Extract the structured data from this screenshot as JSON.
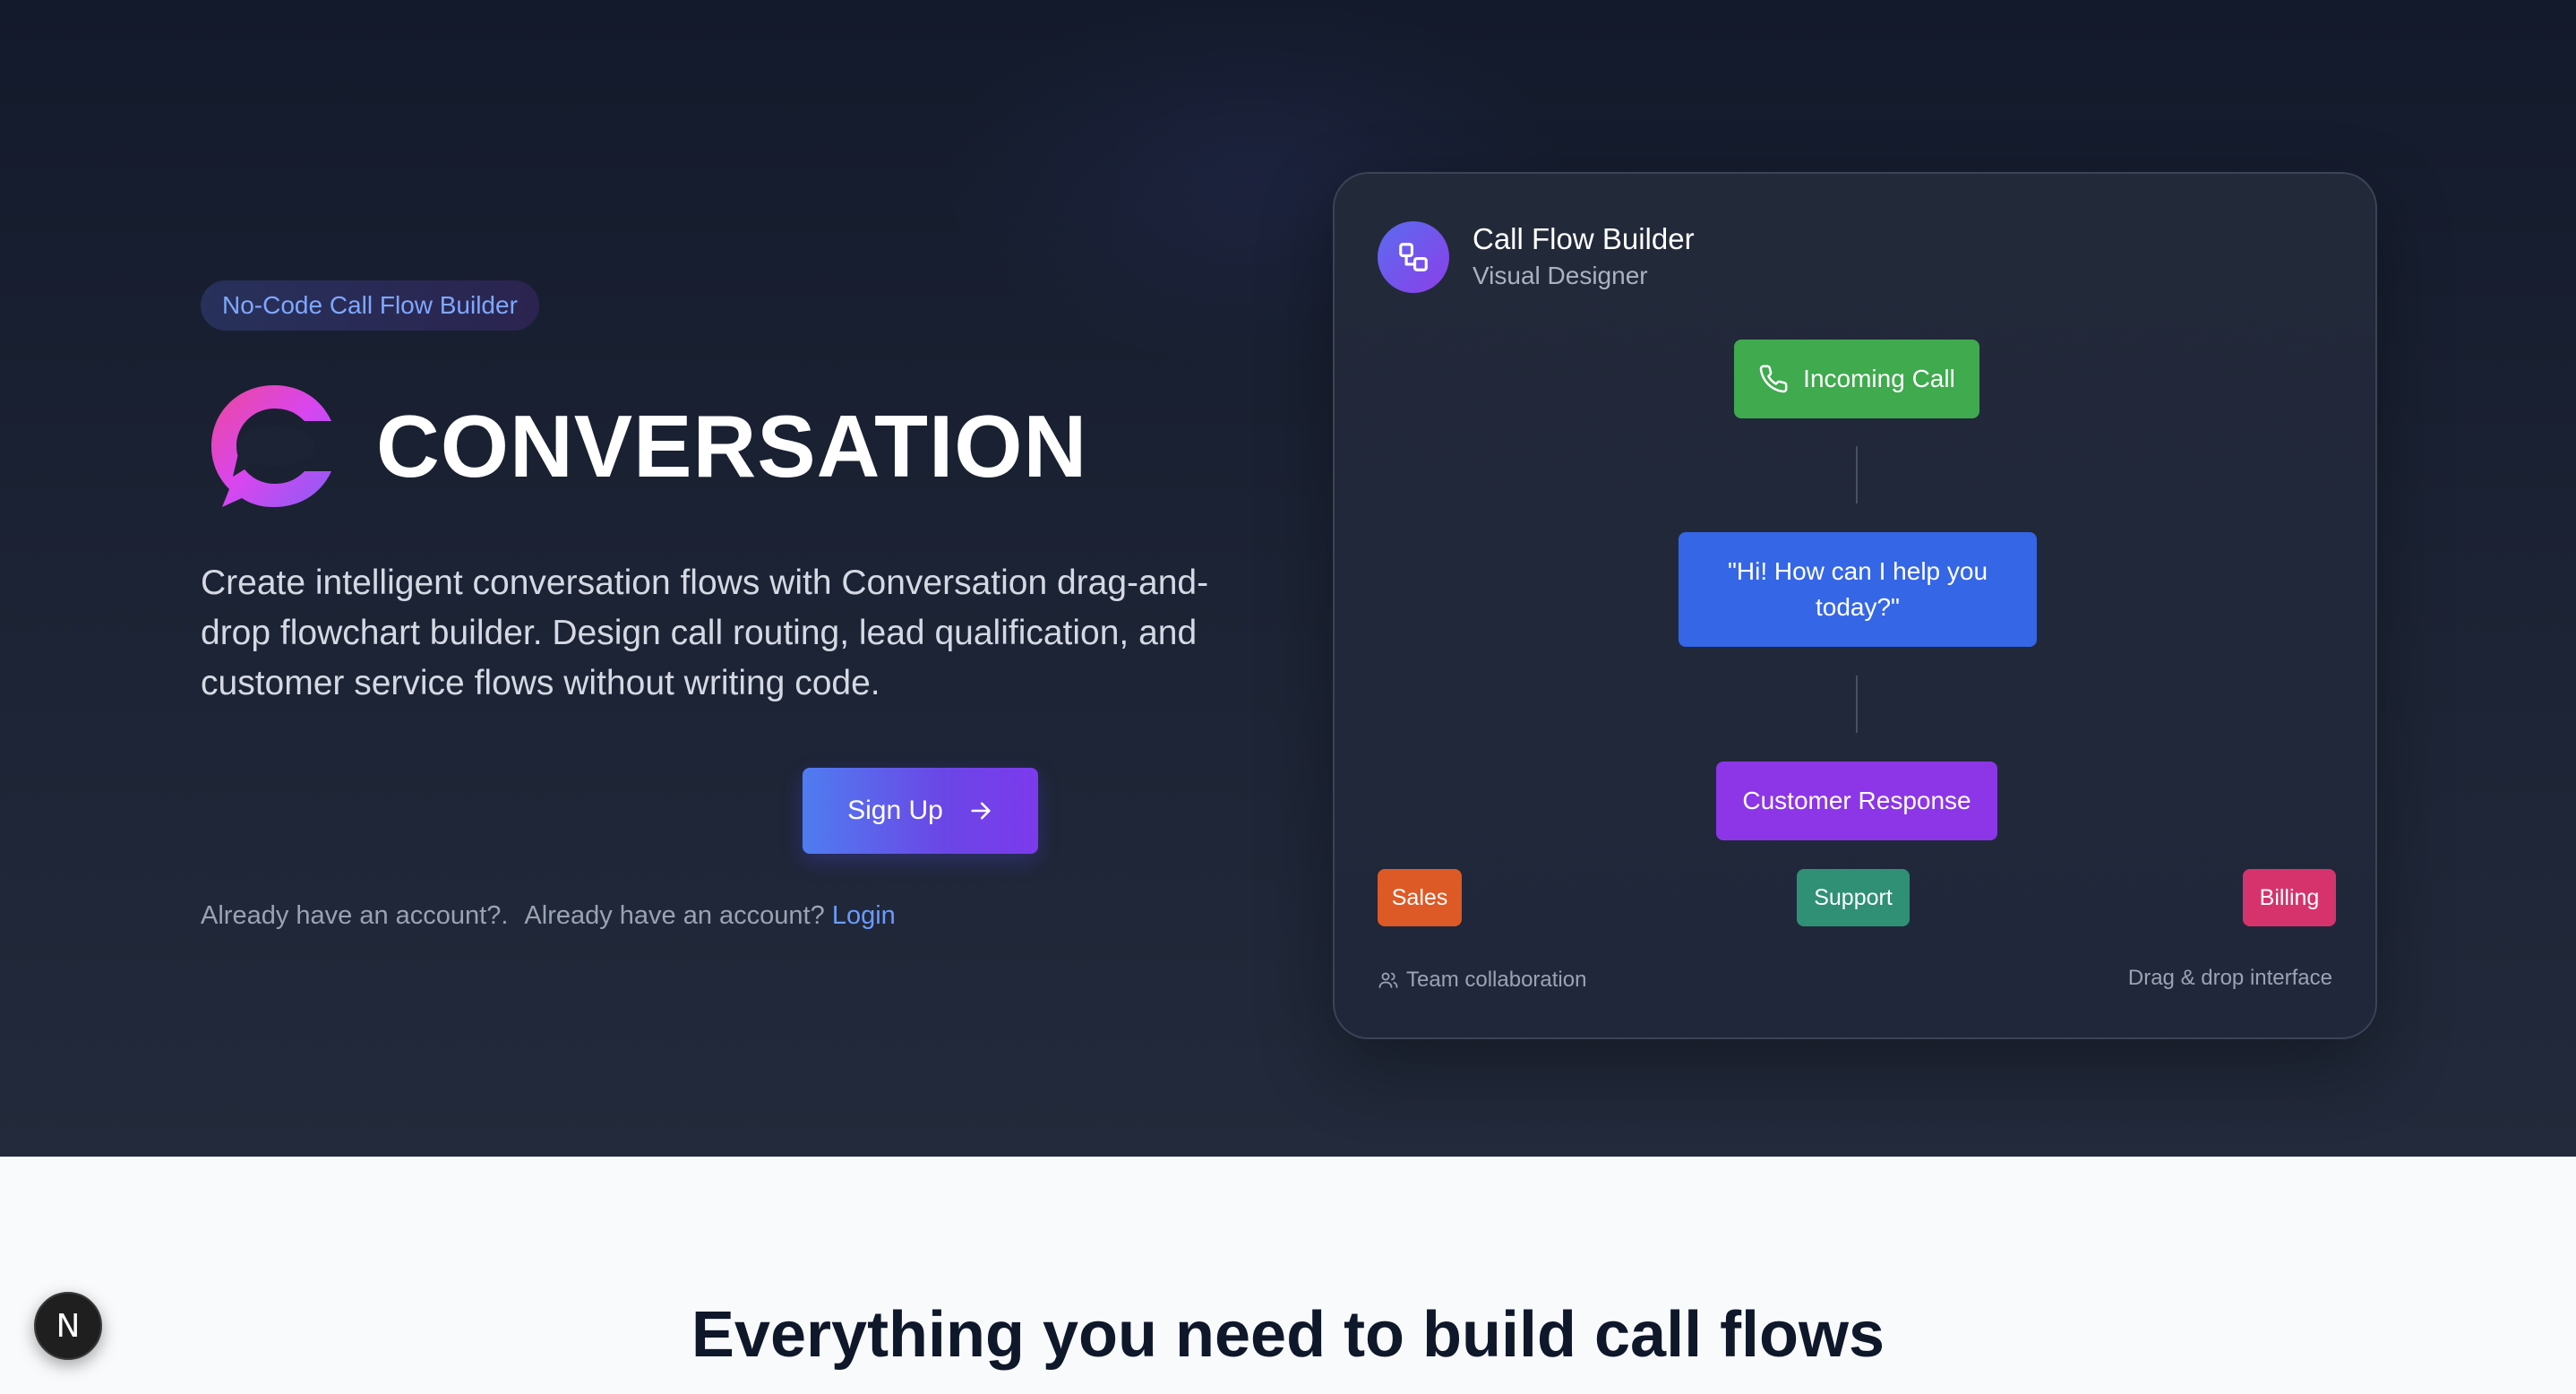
{
  "hero": {
    "badge": "No-Code Call Flow Builder",
    "brand_name": "CONVERSATION",
    "description": "Create intelligent conversation flows with Conversation drag-and-drop flowchart builder. Design call routing, lead qualification, and customer service flows without writing code.",
    "signup_label": "Sign Up",
    "login_prompt_1": "Already have an account?.",
    "login_prompt_2": "Already have an account?",
    "login_link": "Login"
  },
  "card": {
    "title": "Call Flow Builder",
    "subtitle": "Visual Designer",
    "nodes": {
      "incoming": "Incoming Call",
      "greeting": "\"Hi! How can I help you today?\"",
      "response": "Customer Response"
    },
    "chips": {
      "sales": "Sales",
      "support": "Support",
      "billing": "Billing"
    },
    "footer_left": "Team collaboration",
    "footer_right": "Drag & drop interface"
  },
  "features": {
    "title": "Everything you need to build call flows"
  },
  "dev_badge": {
    "letter": "N"
  },
  "colors": {
    "incoming": "#3faa4e",
    "greeting": "#3566e6",
    "response": "#8c36e8",
    "sales": "#dd5a26",
    "support": "#2f9075",
    "billing": "#d6336c",
    "link": "#6b9bff"
  },
  "icons": {
    "brand": "speech-bubble-logo",
    "card": "flow-nodes-icon",
    "incoming": "phone-icon",
    "signup": "arrow-right-icon",
    "footer_left": "users-icon"
  }
}
